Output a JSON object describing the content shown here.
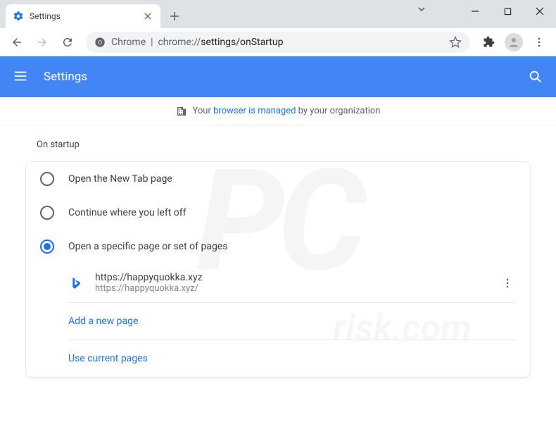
{
  "window": {
    "tab_title": "Settings",
    "url_prefix": "Chrome",
    "url_host": "chrome://",
    "url_path": "settings/onStartup"
  },
  "header": {
    "title": "Settings"
  },
  "managed": {
    "prefix": "Your ",
    "link": "browser is managed",
    "suffix": " by your organization"
  },
  "section": {
    "title": "On startup",
    "options": {
      "newtab": "Open the New Tab page",
      "continue": "Continue where you left off",
      "specific": "Open a specific page or set of pages"
    },
    "page": {
      "name": "https://happyquokka.xyz",
      "url": "https://happyquokka.xyz/"
    },
    "add_page": "Add a new page",
    "use_current": "Use current pages"
  }
}
